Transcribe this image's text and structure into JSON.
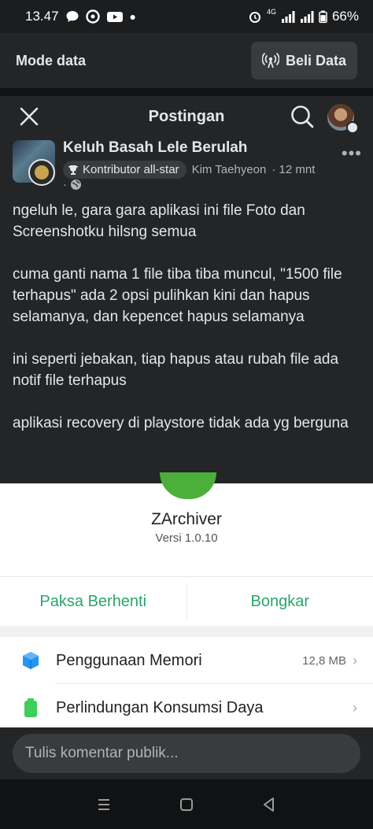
{
  "status_bar": {
    "time": "13.47",
    "battery": "66%",
    "network": "4G"
  },
  "data_bar": {
    "title": "Mode data",
    "buy_button": "Beli Data"
  },
  "post_header": {
    "title": "Postingan"
  },
  "post": {
    "group_name": "Keluh Basah Lele Berulah",
    "badge": "Kontributor all-star",
    "author": "Kim Taehyeon",
    "time": "· 12 mnt",
    "privacy_sep": "·",
    "paragraphs": [
      "ngeluh le, gara gara aplikasi ini file Foto dan Screenshotku hilsng semua",
      "cuma ganti nama 1 file tiba tiba muncul, \"1500 file terhapus\" ada 2 opsi pulihkan kini dan hapus selamanya, dan kepencet hapus selamanya",
      "ini seperti jebakan, tiap hapus atau rubah file ada notif file terhapus",
      "aplikasi recovery di playstore tidak ada yg berguna"
    ]
  },
  "app_screenshot": {
    "app_name": "ZArchiver",
    "version": "Versi 1.0.10",
    "force_stop": "Paksa Berhenti",
    "uninstall": "Bongkar",
    "rows": [
      {
        "label": "Penggunaan Memori",
        "value": "12,8 MB",
        "icon": "memory-cube-icon",
        "color": "#2196f3"
      },
      {
        "label": "Perlindungan Konsumsi Daya",
        "value": "",
        "icon": "battery-icon",
        "color": "#3ccf5a"
      }
    ],
    "accent": "#2aa56a"
  },
  "comment": {
    "placeholder": "Tulis komentar publik..."
  },
  "nav": {
    "icons": [
      "menu-icon",
      "home-icon",
      "back-icon"
    ]
  }
}
